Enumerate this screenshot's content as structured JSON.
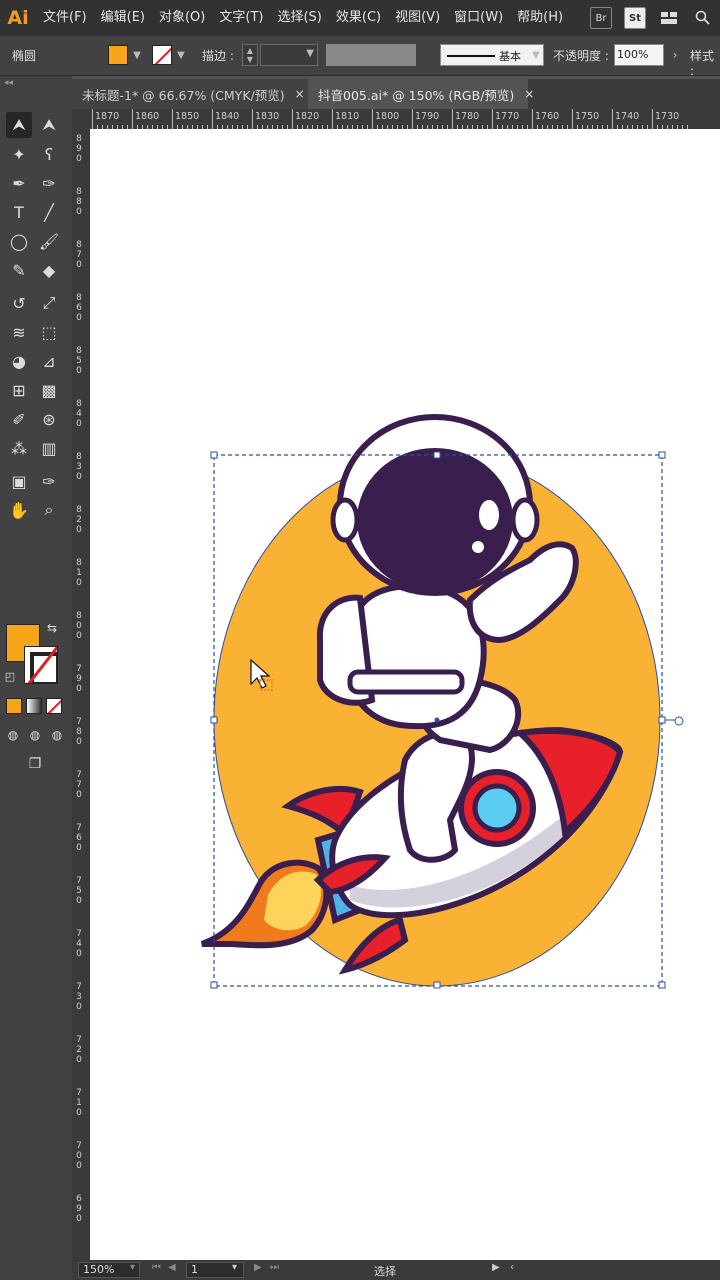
{
  "app": {
    "logo": "Ai"
  },
  "menu": [
    "文件(F)",
    "编辑(E)",
    "对象(O)",
    "文字(T)",
    "选择(S)",
    "效果(C)",
    "视图(V)",
    "窗口(W)",
    "帮助(H)"
  ],
  "menu_right_icons": [
    "bridge-icon",
    "stock-icon",
    "workspace-layout-icon",
    "search-icon"
  ],
  "menu_right_labels": {
    "stock": "St",
    "bridge": "Br"
  },
  "control": {
    "object_type": "椭圆",
    "fill_color": "#f9a51a",
    "stroke_color": "none",
    "stroke_label": "描边 :",
    "brush_label": "基本",
    "opacity_label": "不透明度 :",
    "opacity_value": "100%",
    "style_label": "样式 :"
  },
  "tabs": [
    {
      "label": "未标题-1* @ 66.67% (CMYK/预览)",
      "close": "×",
      "active": false
    },
    {
      "label": "抖音005.ai* @ 150% (RGB/预览)",
      "close": "×",
      "active": true
    }
  ],
  "ruler": {
    "h_labels": [
      "1870",
      "1860",
      "1850",
      "1840",
      "1830",
      "1820",
      "1810",
      "1800",
      "1790",
      "1780",
      "1770",
      "1760",
      "1750",
      "1740",
      "1730"
    ],
    "v_labels": [
      "890",
      "880",
      "870",
      "860",
      "850",
      "840",
      "830",
      "820",
      "810",
      "800",
      "790",
      "780",
      "770",
      "760",
      "750",
      "740",
      "730",
      "720",
      "710",
      "700",
      "690"
    ]
  },
  "tools": [
    "selection-tool",
    "direct-selection-tool",
    "magic-wand-tool",
    "lasso-tool",
    "pen-tool",
    "curvature-tool",
    "type-tool",
    "line-segment-tool",
    "ellipse-tool",
    "paintbrush-tool",
    "pencil-tool",
    "eraser-tool",
    "rotate-tool",
    "scale-tool",
    "width-tool",
    "free-transform-tool",
    "shape-builder-tool",
    "perspective-grid-tool",
    "mesh-tool",
    "gradient-tool",
    "eyedropper-tool",
    "blend-tool",
    "symbol-sprayer-tool",
    "column-graph-tool",
    "artboard-tool",
    "slice-tool",
    "hand-tool",
    "zoom-tool"
  ],
  "tool_glyphs": [
    "⮝",
    "⮝",
    "✦",
    "ʕ",
    "✒",
    "✑",
    "T",
    "╱",
    "◯",
    "🖌",
    "✎",
    "◆",
    "↺",
    "⤢",
    "≋",
    "⬚",
    "◕",
    "⊿",
    "⊞",
    "▩",
    "✐",
    "⊛",
    "⁂",
    "▥",
    "▣",
    "✑",
    "✋",
    "⌕"
  ],
  "swatches": {
    "fill": "#f9a51a",
    "stroke": "none",
    "color_mode": "#f9a51a",
    "gradient_mode": "gradient",
    "none_mode": "none"
  },
  "status": {
    "zoom": "150%",
    "page": "1",
    "label": "选择"
  },
  "artwork": {
    "background_circle_color": "#f9b234",
    "outline_color": "#3a1e4e",
    "suit_color": "#ffffff",
    "shade_color": "#d4d0dc",
    "visor_color": "#3a1e4e",
    "rocket_red": "#e8202a",
    "window_blue": "#5bcdf0",
    "flame_colors": [
      "#f07a1c",
      "#fdd35a"
    ],
    "selection_color": "#2a4da8"
  }
}
